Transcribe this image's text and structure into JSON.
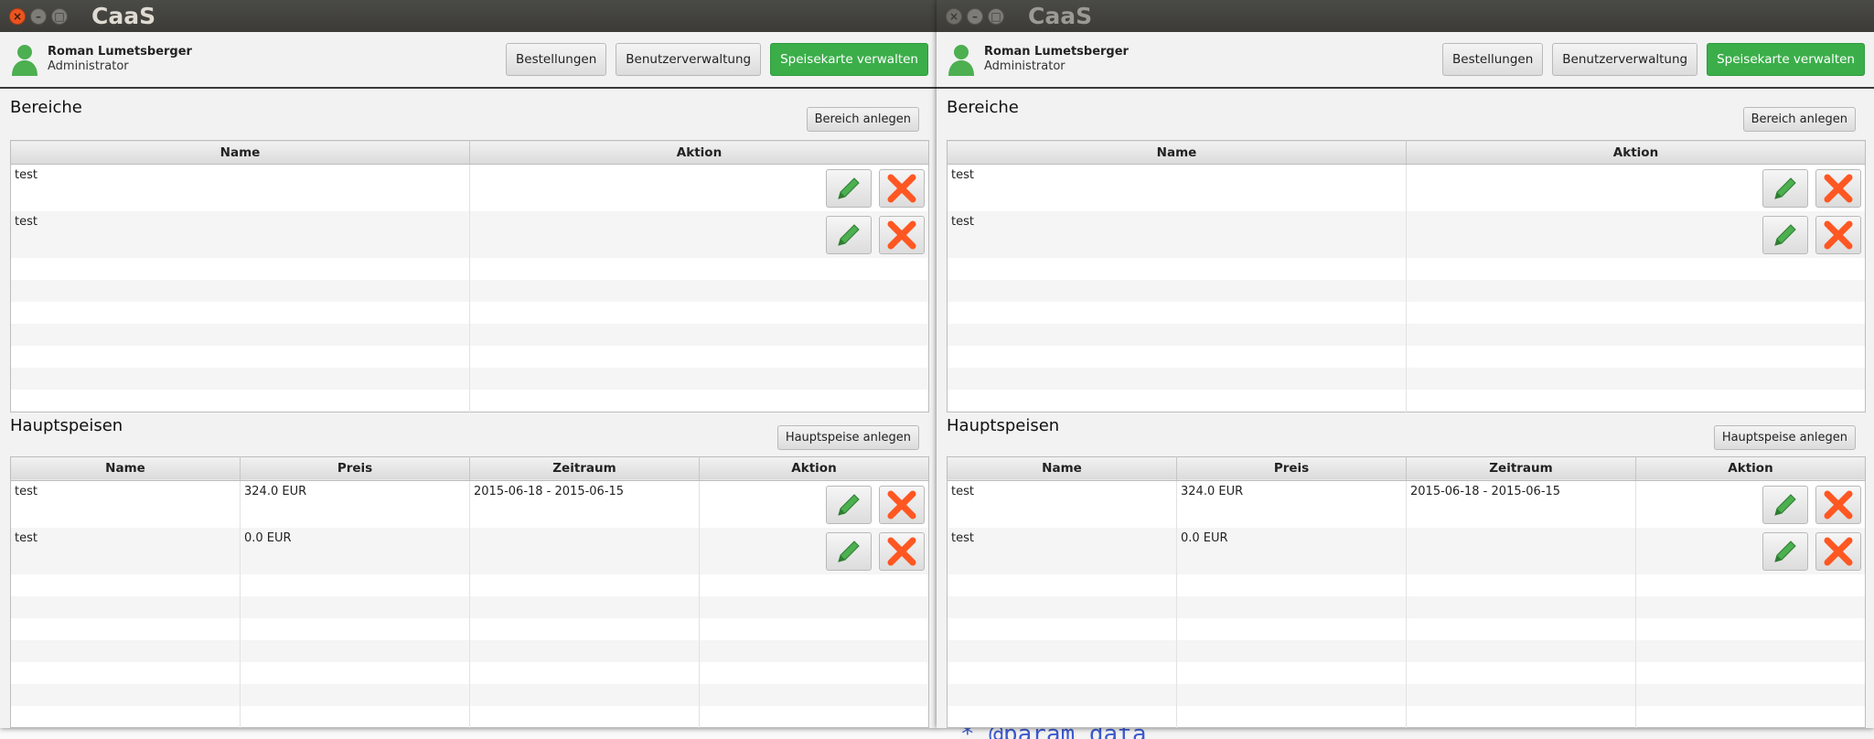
{
  "app": {
    "title": "CaaS"
  },
  "user": {
    "name": "Roman Lumetsberger",
    "role": "Administrator"
  },
  "nav": {
    "orders": "Bestellungen",
    "users": "Benutzerverwaltung",
    "menu": "Speisekarte verwalten"
  },
  "areas": {
    "title": "Bereiche",
    "add_label": "Bereich anlegen",
    "columns": [
      "Name",
      "Aktion"
    ],
    "rows": [
      {
        "name": "test"
      },
      {
        "name": "test"
      }
    ]
  },
  "mains": {
    "title": "Hauptspeisen",
    "add_label": "Hauptspeise anlegen",
    "columns": [
      "Name",
      "Preis",
      "Zeitraum",
      "Aktion"
    ],
    "rows": [
      {
        "name": "test",
        "price": "324.0 EUR",
        "period": "2015-06-18 - 2015-06-15"
      },
      {
        "name": "test",
        "price": "0.0 EUR",
        "period": ""
      }
    ]
  },
  "background_code": "* @param data",
  "icons": {
    "edit": "pencil-icon",
    "delete": "x-delete-icon",
    "user": "user-icon"
  },
  "colors": {
    "accent": "#3bae4a",
    "delete": "#ff5722",
    "edit": "#4caf50"
  }
}
